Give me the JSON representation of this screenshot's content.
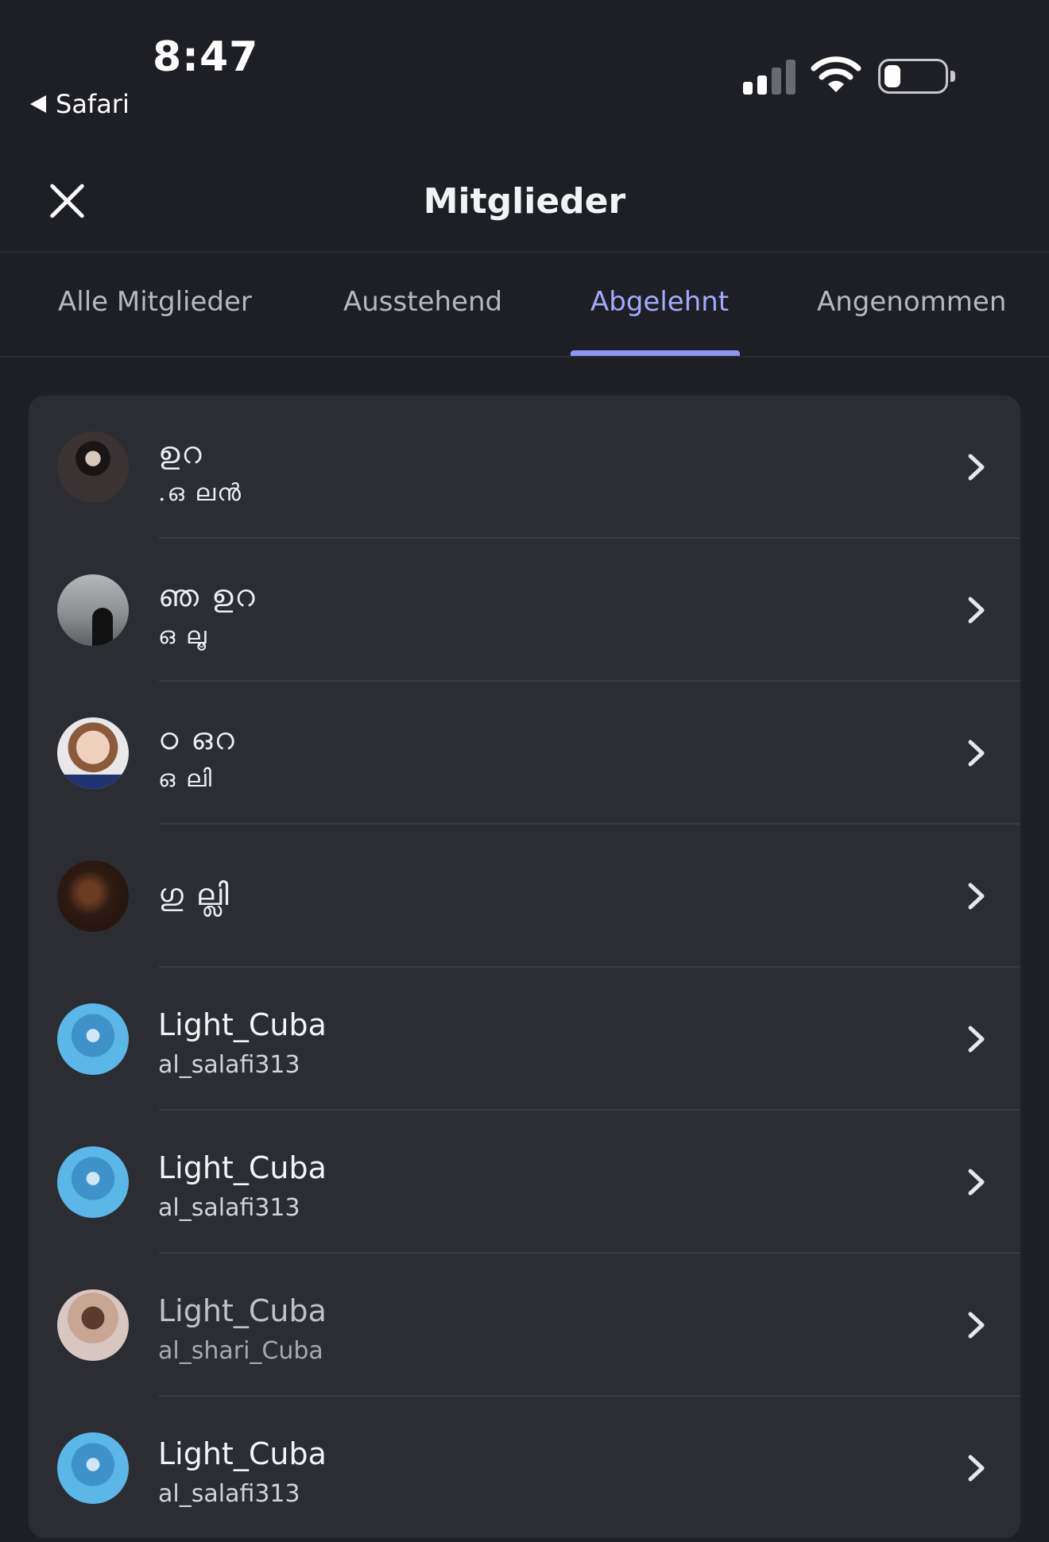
{
  "status_bar": {
    "time": "8:47",
    "back_app": "Safari"
  },
  "header": {
    "title": "Mitglieder"
  },
  "tabs": [
    {
      "label": "Alle Mitglieder",
      "active": false
    },
    {
      "label": "Ausstehend",
      "active": false
    },
    {
      "label": "Abgelehnt",
      "active": true
    },
    {
      "label": "Angenommen",
      "active": false
    }
  ],
  "members": [
    {
      "name": "ഉറ",
      "handle": ".ഒ ലൻ"
    },
    {
      "name": "ഞ ഉറ",
      "handle": "ഒ ലൂ"
    },
    {
      "name": "ഠ ഒറ",
      "handle": "ഒ ലി"
    },
    {
      "name": "ഗു ല്ലി",
      "handle": ""
    },
    {
      "name": "Light_Cuba",
      "handle": "al_salafi313"
    },
    {
      "name": "Light_Cuba",
      "handle": "al_salafi313"
    },
    {
      "name": "Light_Cuba",
      "handle": "al_shari_Cuba"
    },
    {
      "name": "Light_Cuba",
      "handle": "al_salafi313"
    }
  ],
  "colors": {
    "background": "#1e1f24",
    "card": "#2b2d33",
    "accent": "#a4a9fb"
  }
}
